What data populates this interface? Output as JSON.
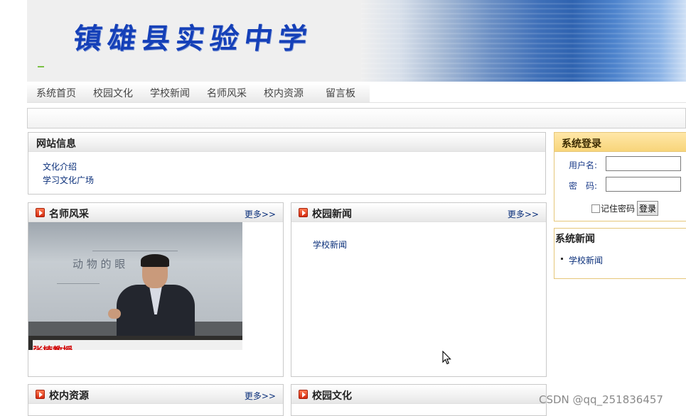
{
  "header": {
    "school_name": "镇雄县实验中学"
  },
  "nav": {
    "items": [
      "系统首页",
      "校园文化",
      "学校新闻",
      "名师风采",
      "校内资源",
      "留言板"
    ]
  },
  "site_info": {
    "title": "网站信息",
    "links": [
      "文化介绍",
      "学习文化广场"
    ]
  },
  "teachers": {
    "title": "名师风采",
    "more": "更多>>",
    "photo_caption": "张楠教授",
    "board_text": "动 物 的 眼"
  },
  "campus_news": {
    "title": "校园新闻",
    "more": "更多>>",
    "items": [
      "学校新闻"
    ]
  },
  "resources": {
    "title": "校内资源",
    "more": "更多>>"
  },
  "culture": {
    "title": "校园文化"
  },
  "login": {
    "title": "系统登录",
    "username_label": "用户名:",
    "password_label": "密　码:",
    "username_value": "",
    "password_value": "",
    "remember_label": "记住密码",
    "submit_label": "登录"
  },
  "system_news": {
    "title": "系统新闻",
    "items": [
      "学校新闻"
    ]
  },
  "watermark": "CSDN @qq_251836457",
  "colors": {
    "banner_blue": "#2f63b0",
    "title_blue": "#1540b8",
    "link_blue": "#0a2f7a",
    "login_header": "#f8d57a",
    "caption_red": "#d10000"
  }
}
